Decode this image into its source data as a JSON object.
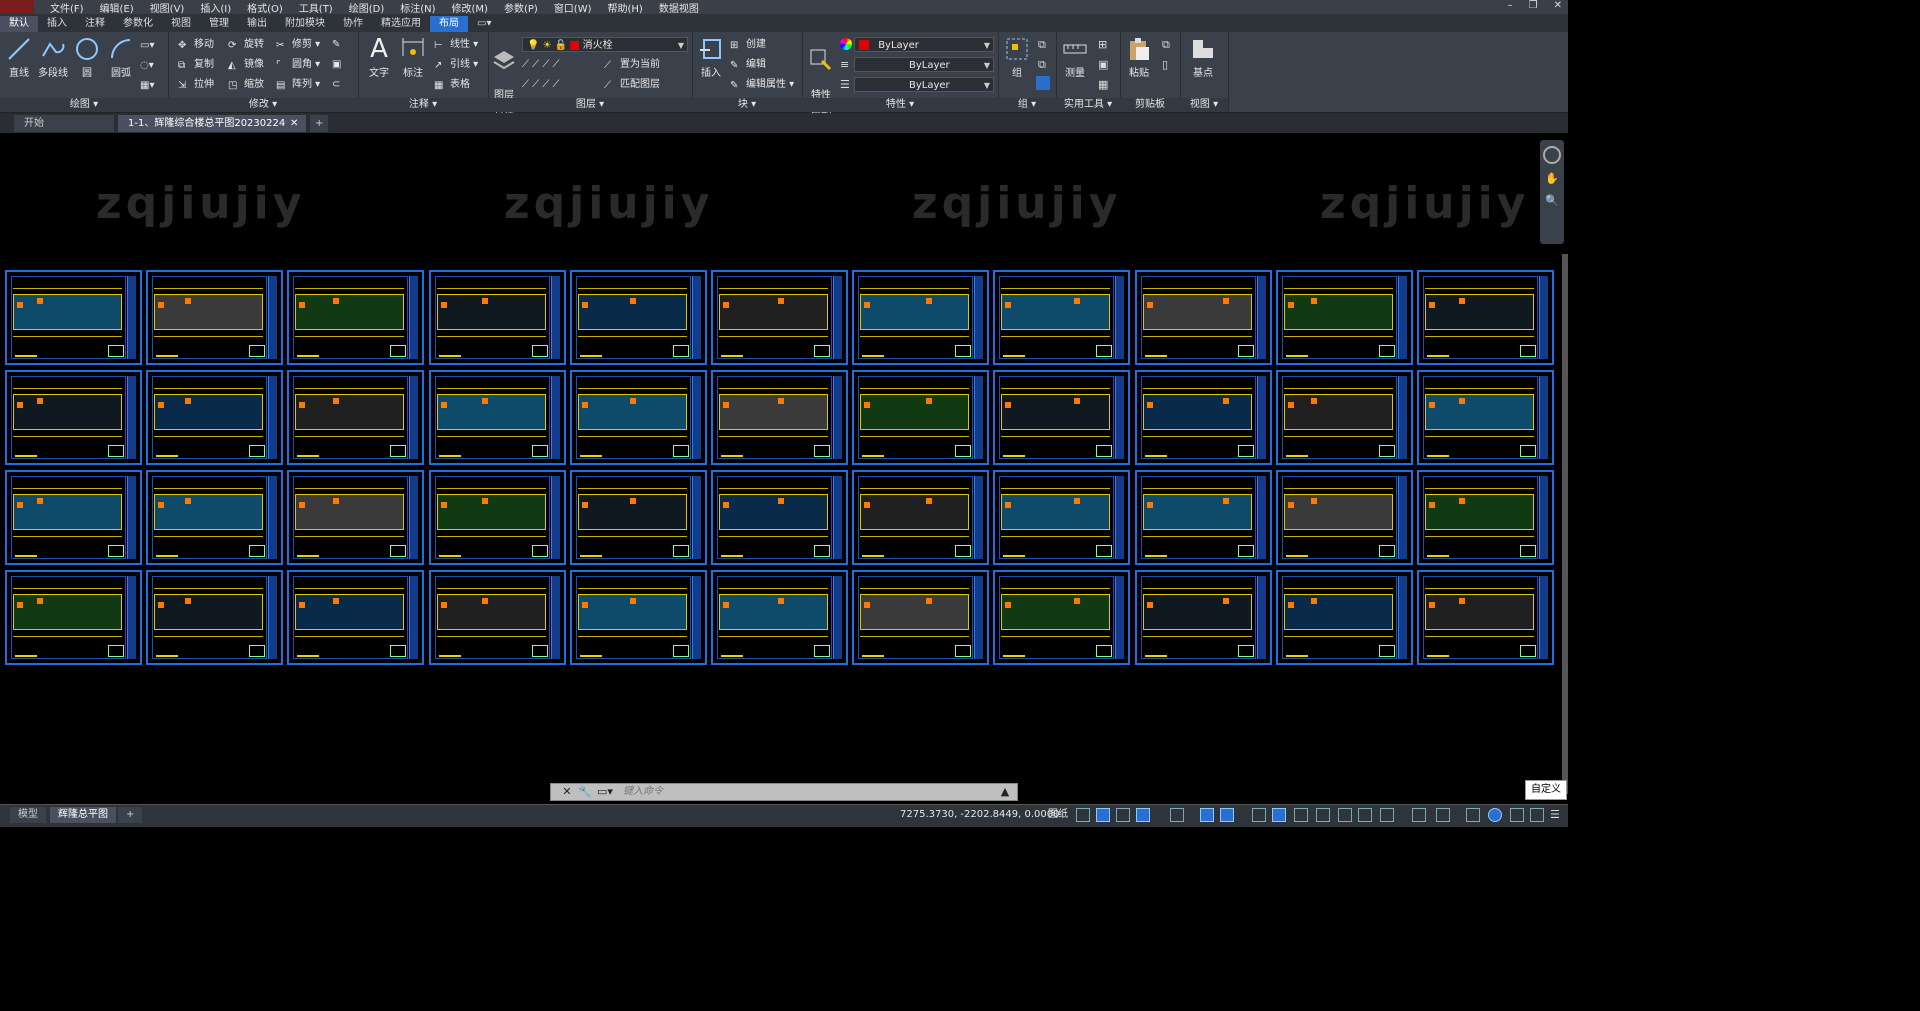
{
  "menu": [
    "文件(F)",
    "编辑(E)",
    "视图(V)",
    "插入(I)",
    "格式(O)",
    "工具(T)",
    "绘图(D)",
    "标注(N)",
    "修改(M)",
    "参数(P)",
    "窗口(W)",
    "帮助(H)",
    "数据视图"
  ],
  "ribbon_tabs": [
    "默认",
    "插入",
    "注释",
    "参数化",
    "视图",
    "管理",
    "输出",
    "附加模块",
    "协作",
    "精选应用",
    "布局"
  ],
  "ribbon_active_tab": "默认",
  "draw": {
    "title": "绘图",
    "line": "直线",
    "polyline": "多段线",
    "circle": "圆",
    "arc": "圆弧"
  },
  "modify": {
    "title": "修改",
    "move": "移动",
    "rotate": "旋转",
    "trim": "修剪",
    "copy": "复制",
    "mirror": "镜像",
    "fillet": "圆角",
    "stretch": "拉伸",
    "scale": "缩放",
    "array": "阵列"
  },
  "annotation": {
    "title": "注释",
    "text": "文字",
    "dimension": "标注",
    "linear": "线性",
    "leader": "引线",
    "table": "表格"
  },
  "layers": {
    "title": "图层",
    "properties": "图层\n特性",
    "current_layer": "消火栓",
    "set_current": "置为当前",
    "match": "匹配图层"
  },
  "block": {
    "title": "块",
    "insert": "插入",
    "create": "创建",
    "edit": "编辑",
    "edit_attr": "编辑属性"
  },
  "properties": {
    "title": "特性",
    "match": "特性\n匹配",
    "color": "ByLayer",
    "linetype": "ByLayer",
    "lineweight": "ByLayer"
  },
  "group": {
    "title": "组",
    "group": "组"
  },
  "utilities": {
    "title": "实用工具",
    "measure": "测量"
  },
  "clipboard": {
    "title": "剪贴板",
    "paste": "粘贴"
  },
  "view": {
    "title": "视图",
    "base": "基点"
  },
  "doc_tabs": {
    "start": "开始",
    "drawing": "1-1、辉隆综合楼总平图20230224*"
  },
  "watermark": "zqjiujiy",
  "command": {
    "placeholder": "键入命令"
  },
  "tooltip": "自定义",
  "layout_tabs": {
    "model": "模型",
    "layout": "辉隆总平图"
  },
  "status": {
    "coords": "7275.3730, -2202.8449, 0.0000",
    "paper": "图纸"
  },
  "colors": {
    "accent": "#1f6fe0",
    "ribbon_bg": "#3b414a",
    "layer_swatch": "#e00000"
  },
  "sheets": {
    "rows": 4,
    "cols": 11
  }
}
